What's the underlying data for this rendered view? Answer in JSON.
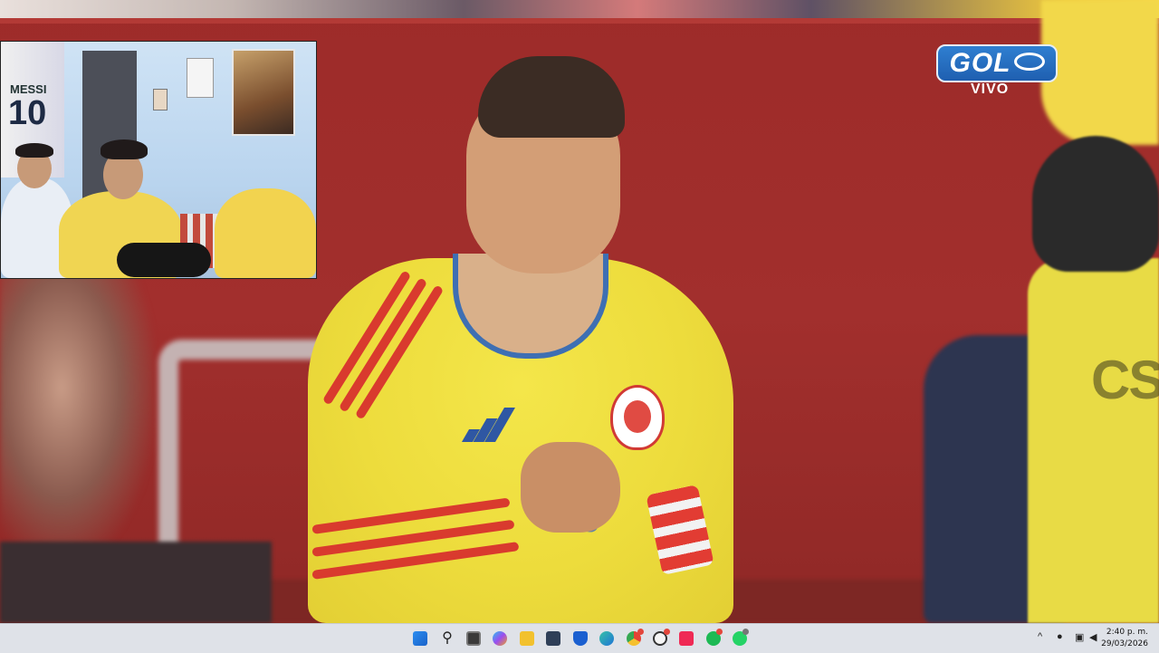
{
  "broadcast": {
    "logo_text": "GOL",
    "live_label": "VIVO",
    "player_number_partial": "10"
  },
  "webcam": {
    "jersey_name": "MESSI",
    "jersey_number": "10"
  },
  "taskbar": {
    "items": [
      {
        "name": "windows-start-icon"
      },
      {
        "name": "search-icon"
      },
      {
        "name": "task-view-icon"
      },
      {
        "name": "copilot-icon"
      },
      {
        "name": "file-explorer-icon"
      },
      {
        "name": "microsoft-store-icon"
      },
      {
        "name": "defender-icon"
      },
      {
        "name": "edge-icon"
      },
      {
        "name": "chrome-icon"
      },
      {
        "name": "chatgpt-icon"
      },
      {
        "name": "tiktok-icon"
      },
      {
        "name": "spotify-icon"
      },
      {
        "name": "whatsapp-icon"
      }
    ],
    "tray": {
      "chevron": "^",
      "time": "2:40 p. m.",
      "date": "29/03/2026"
    },
    "colors": {
      "accent_blue": "#1f6fd6",
      "badge_red": "#e3463c"
    }
  }
}
